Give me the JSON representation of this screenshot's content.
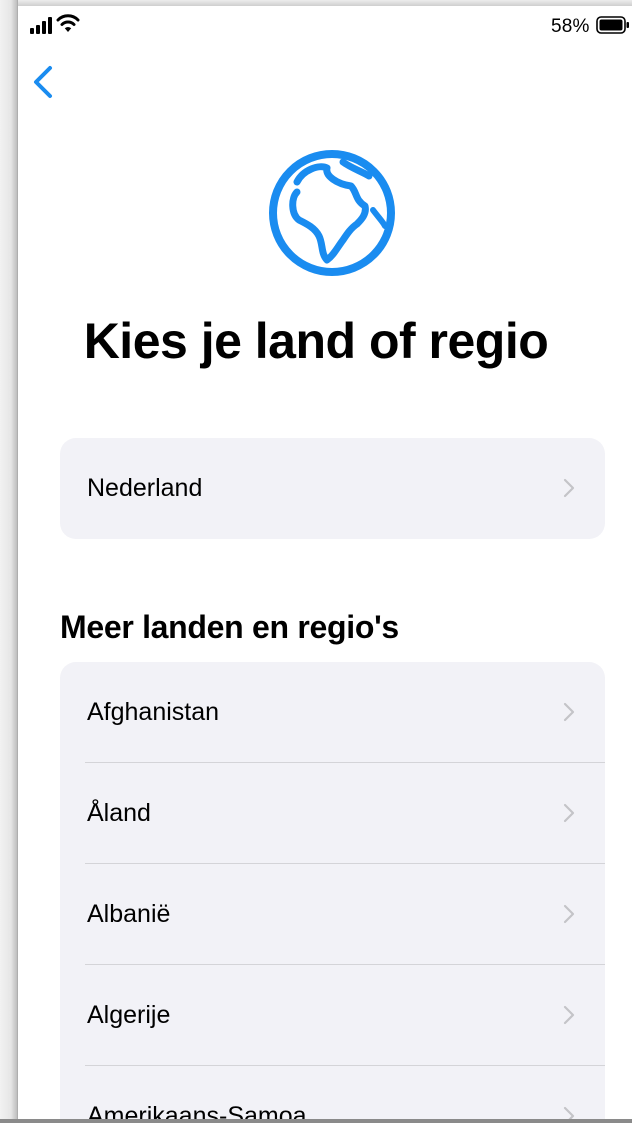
{
  "status_bar": {
    "battery_percent": "58%"
  },
  "title": "Kies je land of regio",
  "suggested": {
    "items": [
      {
        "label": "Nederland"
      }
    ]
  },
  "more": {
    "header": "Meer landen en regio's",
    "items": [
      {
        "label": "Afghanistan"
      },
      {
        "label": "Åland"
      },
      {
        "label": "Albanië"
      },
      {
        "label": "Algerije"
      },
      {
        "label": "Amerikaans-Samoa"
      }
    ]
  },
  "colors": {
    "accent": "#1a8cf0",
    "card_background": "#f2f2f7",
    "chevron": "#c4c4c8"
  },
  "icons": {
    "back": "chevron-left-icon",
    "globe": "globe-europe-africa-icon",
    "row": "chevron-right-icon"
  }
}
